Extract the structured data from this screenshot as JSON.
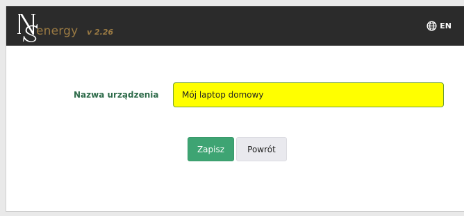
{
  "header": {
    "brand": "energy",
    "version": "v 2.26",
    "language": "EN",
    "language_icon": "globe-icon",
    "logo_icon": "ns-monogram-logo"
  },
  "form": {
    "device_name_label": "Nazwa urządzenia",
    "device_name_value": "Mój laptop domowy",
    "save_label": "Zapisz",
    "back_label": "Powrót"
  },
  "colors": {
    "header_bg": "#2b2b2b",
    "brand_text": "#9a7a43",
    "label_text": "#2e6b4a",
    "input_highlight": "#ffff00",
    "input_border": "#6e9e32",
    "save_button": "#3ea473",
    "back_button": "#e9e9ee"
  }
}
